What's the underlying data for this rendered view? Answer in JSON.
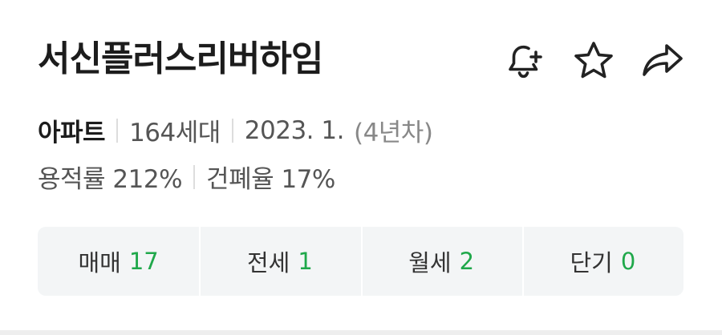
{
  "property": {
    "name": "서신플러스리버하임"
  },
  "icons": {
    "alert": "bell-plus-icon",
    "favorite": "star-icon",
    "share": "share-arrow-icon"
  },
  "info": {
    "type": "아파트",
    "households": "164세대",
    "completion": "2023. 1.",
    "age": "(4년차)",
    "floor_area_ratio": "용적률 212%",
    "building_coverage": "건폐율 17%"
  },
  "deals": [
    {
      "label": "매매",
      "count": "17"
    },
    {
      "label": "전세",
      "count": "1"
    },
    {
      "label": "월세",
      "count": "2"
    },
    {
      "label": "단기",
      "count": "0"
    }
  ],
  "colors": {
    "count": "#1fa84a",
    "panel_bg": "#f3f5f6",
    "title": "#1c1c1c"
  }
}
